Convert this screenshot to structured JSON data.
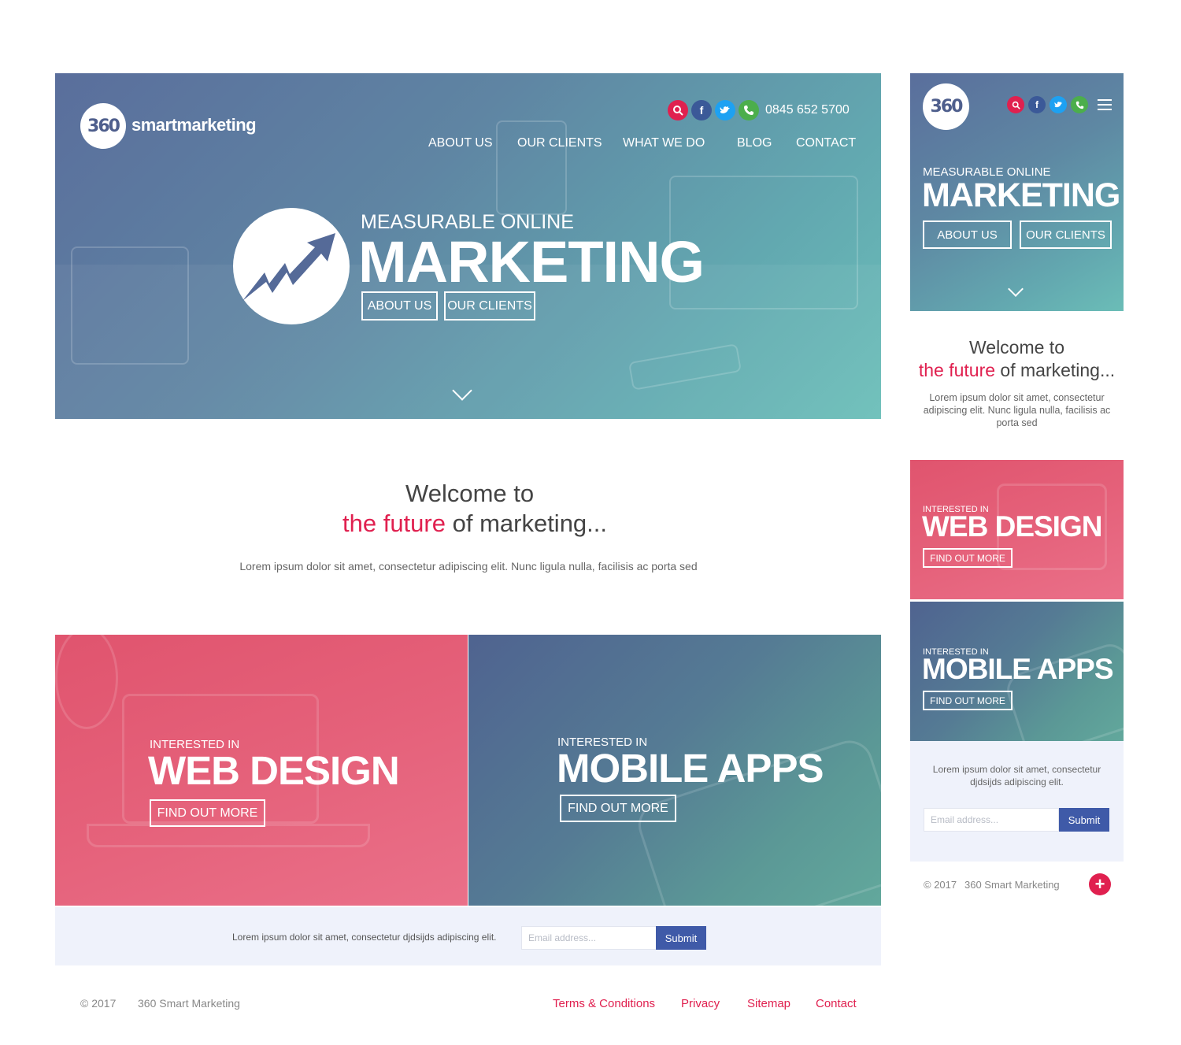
{
  "brand": {
    "logo_text": "360",
    "name": "smartmarketing"
  },
  "contact": {
    "phone": "0845 652 5700"
  },
  "icons": {
    "search": "search-icon",
    "facebook": "facebook-icon",
    "twitter": "twitter-icon",
    "phone": "phone-icon",
    "menu": "hamburger-icon",
    "plus": "plus-icon",
    "chevron": "chevron-down-icon",
    "emblem": "growth-arrow-icon"
  },
  "colors": {
    "accent": "#e0204f",
    "primary_blue": "#3f5aa8",
    "hero_from": "#5a6e9c",
    "hero_to": "#6bbfb9",
    "panel_bg": "#eff2fb"
  },
  "nav": [
    "ABOUT US",
    "OUR CLIENTS",
    "WHAT WE DO",
    "BLOG",
    "CONTACT"
  ],
  "hero": {
    "subtitle": "MEASURABLE ONLINE",
    "title": "MARKETING",
    "buttons": [
      "ABOUT US",
      "OUR CLIENTS"
    ]
  },
  "welcome": {
    "line1": "Welcome to",
    "accent": "the future",
    "rest": " of marketing...",
    "body": "Lorem ipsum dolor sit amet, consectetur adipiscing elit. Nunc ligula nulla, facilisis ac porta sed",
    "body_mobile": "Lorem ipsum dolor sit amet, consectetur adipiscing elit. Nunc ligula nulla, facilisis ac porta sed"
  },
  "tiles": [
    {
      "kicker": "INTERESTED IN",
      "title": "WEB DESIGN",
      "button": "FIND OUT MORE"
    },
    {
      "kicker": "INTERESTED IN",
      "title": "MOBILE APPS",
      "button": "FIND OUT MORE"
    }
  ],
  "newsletter": {
    "text": "Lorem ipsum dolor sit amet, consectetur djdsijds adipiscing elit.",
    "text_mobile": "Lorem ipsum dolor sit amet, consectetur djdsijds adipiscing elit.",
    "placeholder": "Email address...",
    "submit": "Submit"
  },
  "footer": {
    "year": "© 2017",
    "company": "360 Smart Marketing",
    "links": [
      "Terms & Conditions",
      "Privacy",
      "Sitemap",
      "Contact"
    ]
  }
}
